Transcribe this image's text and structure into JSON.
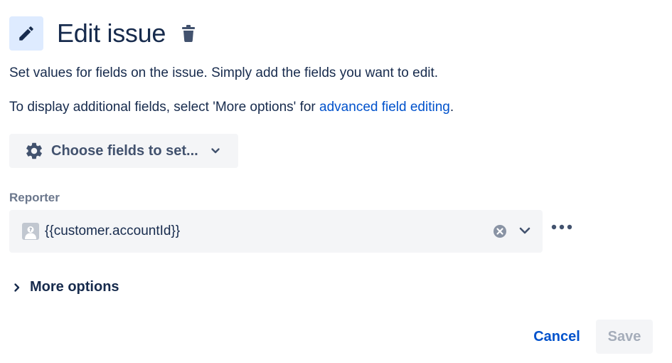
{
  "header": {
    "title": "Edit issue",
    "edit_icon": "pencil-icon",
    "delete_icon": "trash-icon"
  },
  "description": {
    "line1": "Set values for fields on the issue. Simply add the fields you want to edit.",
    "line2_prefix": "To display additional fields, select 'More options' for ",
    "line2_link": "advanced field editing",
    "line2_suffix": "."
  },
  "choose_fields": {
    "label": "Choose fields to set...",
    "icon": "gear-icon",
    "chevron": "chevron-down-icon"
  },
  "reporter": {
    "label": "Reporter",
    "value": "{{customer.accountId}}",
    "avatar_icon": "user-avatar-icon",
    "clear_icon": "clear-icon",
    "dropdown_icon": "chevron-down-icon",
    "more_icon": "more-icon"
  },
  "more_options": {
    "label": "More options",
    "icon": "chevron-right-icon"
  },
  "footer": {
    "cancel_label": "Cancel",
    "save_label": "Save"
  },
  "colors": {
    "text": "#172b4d",
    "link": "#0052cc",
    "subtle_text": "#6b778c",
    "field_bg": "#f4f5f7",
    "icon_bg": "#deebff",
    "disabled_text": "#a5adba"
  }
}
